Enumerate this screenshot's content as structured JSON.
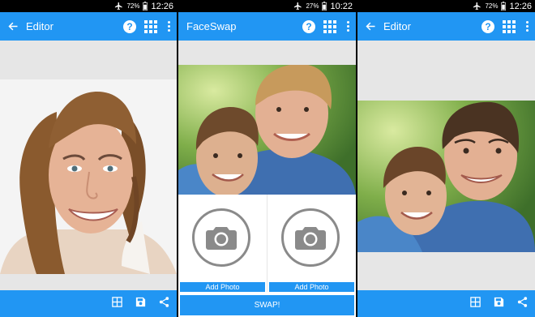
{
  "colors": {
    "accent": "#2196f3",
    "status_bar": "#000000",
    "background": "#e6e6e6"
  },
  "panels": [
    {
      "status": {
        "battery_pct": "72%",
        "time": "12:26"
      },
      "appbar": {
        "title": "Editor",
        "back_icon": "arrow-left-icon",
        "actions": [
          "help-icon",
          "grid-icon",
          "more-vert-icon"
        ]
      },
      "bottom_actions": [
        "grid-view-icon",
        "save-icon",
        "share-icon"
      ]
    },
    {
      "status": {
        "battery_pct": "27%",
        "time": "10:22"
      },
      "appbar": {
        "title": "FaceSwap",
        "actions": [
          "help-icon",
          "grid-icon",
          "more-vert-icon"
        ]
      },
      "slots": [
        {
          "label": "Add Photo"
        },
        {
          "label": "Add Photo"
        }
      ],
      "swap_label": "SWAP!"
    },
    {
      "status": {
        "battery_pct": "72%",
        "time": "12:26"
      },
      "appbar": {
        "title": "Editor",
        "back_icon": "arrow-left-icon",
        "actions": [
          "help-icon",
          "grid-icon",
          "more-vert-icon"
        ]
      },
      "bottom_actions": [
        "grid-view-icon",
        "save-icon",
        "share-icon"
      ]
    }
  ]
}
